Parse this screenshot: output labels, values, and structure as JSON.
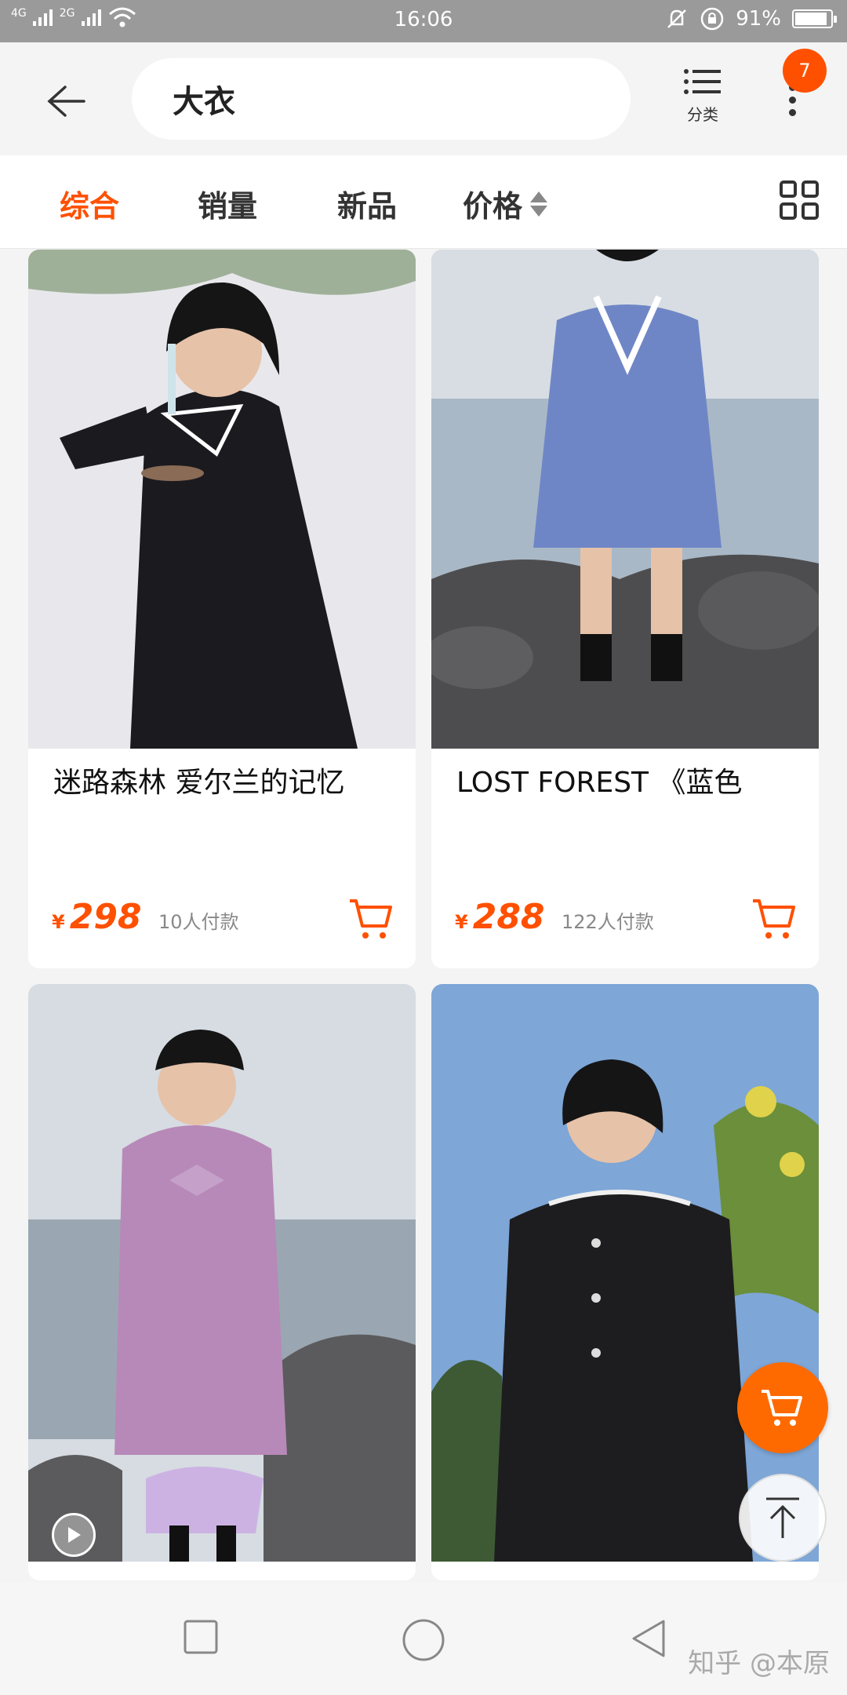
{
  "status_bar": {
    "network_1": "4G",
    "network_2": "2G",
    "time": "16:06",
    "battery": "91%",
    "battery_level": 0.91
  },
  "header": {
    "search_query": "大衣",
    "category_label": "分类",
    "badge_count": "7"
  },
  "sort_tabs": [
    {
      "label": "综合",
      "active": true
    },
    {
      "label": "销量",
      "active": false
    },
    {
      "label": "新品",
      "active": false
    },
    {
      "label": "价格",
      "active": false
    }
  ],
  "products": [
    {
      "title": "迷路森林 爱尔兰的记忆",
      "currency": "¥",
      "price": "298",
      "sold": "10人付款",
      "coat_color": "#1b1a1f",
      "bg": "#e9e9ee"
    },
    {
      "title": "LOST FOREST 《蓝色",
      "currency": "¥",
      "price": "288",
      "sold": "122人付款",
      "coat_color": "#6f86c6",
      "bg": "#b9c6d3"
    },
    {
      "title": "",
      "currency": "",
      "price": "",
      "sold": "",
      "coat_color": "#b789b8",
      "bg": "#c9d2da"
    },
    {
      "title": "",
      "currency": "",
      "price": "",
      "sold": "",
      "coat_color": "#1d1d1f",
      "bg": "#7ea6d6"
    }
  ],
  "colors": {
    "accent": "#ff5000",
    "fab_cart": "#ff6a00"
  },
  "watermark": "知乎 @本原"
}
